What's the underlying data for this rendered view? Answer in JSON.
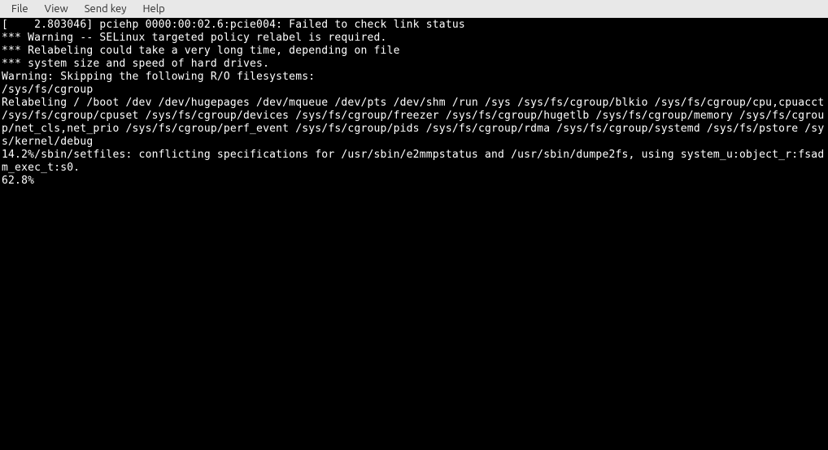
{
  "menubar": {
    "file": "File",
    "view": "View",
    "sendkey": "Send key",
    "help": "Help"
  },
  "terminal": {
    "line1": "[    2.803046] pciehp 0000:00:02.6:pcie004: Failed to check link status",
    "line2": "",
    "line3": "*** Warning -- SELinux targeted policy relabel is required.",
    "line4": "*** Relabeling could take a very long time, depending on file",
    "line5": "*** system size and speed of hard drives.",
    "line6": "Warning: Skipping the following R/O filesystems:",
    "line7": "/sys/fs/cgroup",
    "line8": "Relabeling / /boot /dev /dev/hugepages /dev/mqueue /dev/pts /dev/shm /run /sys /sys/fs/cgroup/blkio /sys/fs/cgroup/cpu,cpuacct /sys/fs/cgroup/cpuset /sys/fs/cgroup/devices /sys/fs/cgroup/freezer /sys/fs/cgroup/hugetlb /sys/fs/cgroup/memory /sys/fs/cgroup/net_cls,net_prio /sys/fs/cgroup/perf_event /sys/fs/cgroup/pids /sys/fs/cgroup/rdma /sys/fs/cgroup/systemd /sys/fs/pstore /sys/kernel/debug",
    "line9": "14.2%/sbin/setfiles: conflicting specifications for /usr/sbin/e2mmpstatus and /usr/sbin/dumpe2fs, using system_u:object_r:fsadm_exec_t:s0.",
    "line10": "62.8%"
  }
}
